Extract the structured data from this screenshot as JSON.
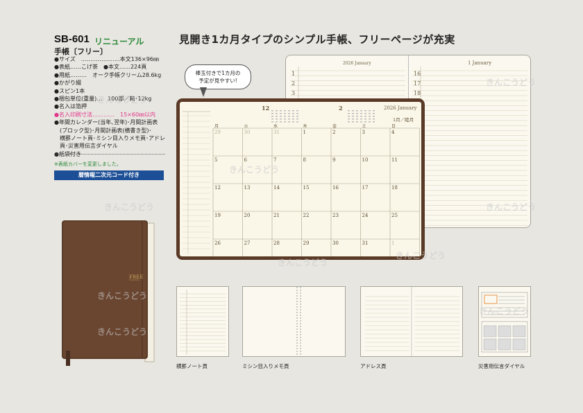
{
  "product": {
    "code": "SB-601",
    "status": "リニューアル",
    "name": "手帳〔フリー〕"
  },
  "specs": [
    {
      "text": "●サイズ　…………………本文136×96㎜",
      "highlight": false
    },
    {
      "text": "●表紙……こげ茶　●本文……224頁",
      "highlight": false
    },
    {
      "text": "●用紙………　オーク手帳クリーム28.6kg",
      "highlight": false
    },
    {
      "text": "●かがり綴",
      "highlight": false
    },
    {
      "text": "●スピン1本",
      "highlight": false
    },
    {
      "text": "●梱包単位(重量)…　100部／箱･12kg",
      "highlight": false
    },
    {
      "text": "●名入は箔押",
      "highlight": false
    },
    {
      "text": "●名入印刷寸法…………　15×60㎜以内",
      "highlight": true
    },
    {
      "text": "●年間カレンダー(当年､翌年)･月間計画表",
      "highlight": false
    },
    {
      "text": "　(ブロック型)･月間計画表(横書き型)･",
      "highlight": false
    },
    {
      "text": "　横罫ノート頁･ミシン目入りメモ頁･アドレス",
      "highlight": false
    },
    {
      "text": "　頁･災害用伝言ダイヤル",
      "highlight": false
    },
    {
      "text": "●紙袋付き",
      "highlight": false
    }
  ],
  "cover_note": "※表紙カバーを変更しました。",
  "qr_label": "暦情報二次元コード付き",
  "book_label": "FREE",
  "headline": "見開き1カ月タイプのシンプル手帳、フリーページが充実",
  "bubble": {
    "line1": "棒玉付きで1カ月の",
    "line2": "予定が見やすい!"
  },
  "spread": {
    "left_month": "2026 January",
    "right_month": "1 January",
    "left_days": [
      "1",
      "2",
      "3"
    ],
    "right_days": [
      "16",
      "17",
      "18"
    ]
  },
  "planner": {
    "year_month": "2026 January",
    "month_jp": "1月／睦月",
    "prev_month": "12",
    "next_month": "2",
    "weekdays": [
      "月",
      "火",
      "水",
      "木",
      "金",
      "土",
      "日"
    ],
    "weeks": [
      [
        "29",
        "30",
        "31",
        "1",
        "2",
        "3",
        "4"
      ],
      [
        "5",
        "6",
        "7",
        "8",
        "9",
        "10",
        "11"
      ],
      [
        "12",
        "13",
        "14",
        "15",
        "16",
        "17",
        "18"
      ],
      [
        "19",
        "20",
        "21",
        "22",
        "23",
        "24",
        "25"
      ],
      [
        "26",
        "27",
        "28",
        "29",
        "30",
        "31",
        "1"
      ]
    ]
  },
  "thumbnails": [
    {
      "caption": "横罫ノート頁"
    },
    {
      "caption": "ミシン目入りメモ頁"
    },
    {
      "caption": "アドレス頁"
    },
    {
      "caption": "災害用伝言ダイヤル"
    }
  ],
  "watermark": "きんこうどう",
  "colors": {
    "accent_green": "#2a8a3a",
    "highlight_pink": "#e0378a",
    "label_blue": "#1d4f96",
    "cover_brown": "#5a3a26"
  }
}
